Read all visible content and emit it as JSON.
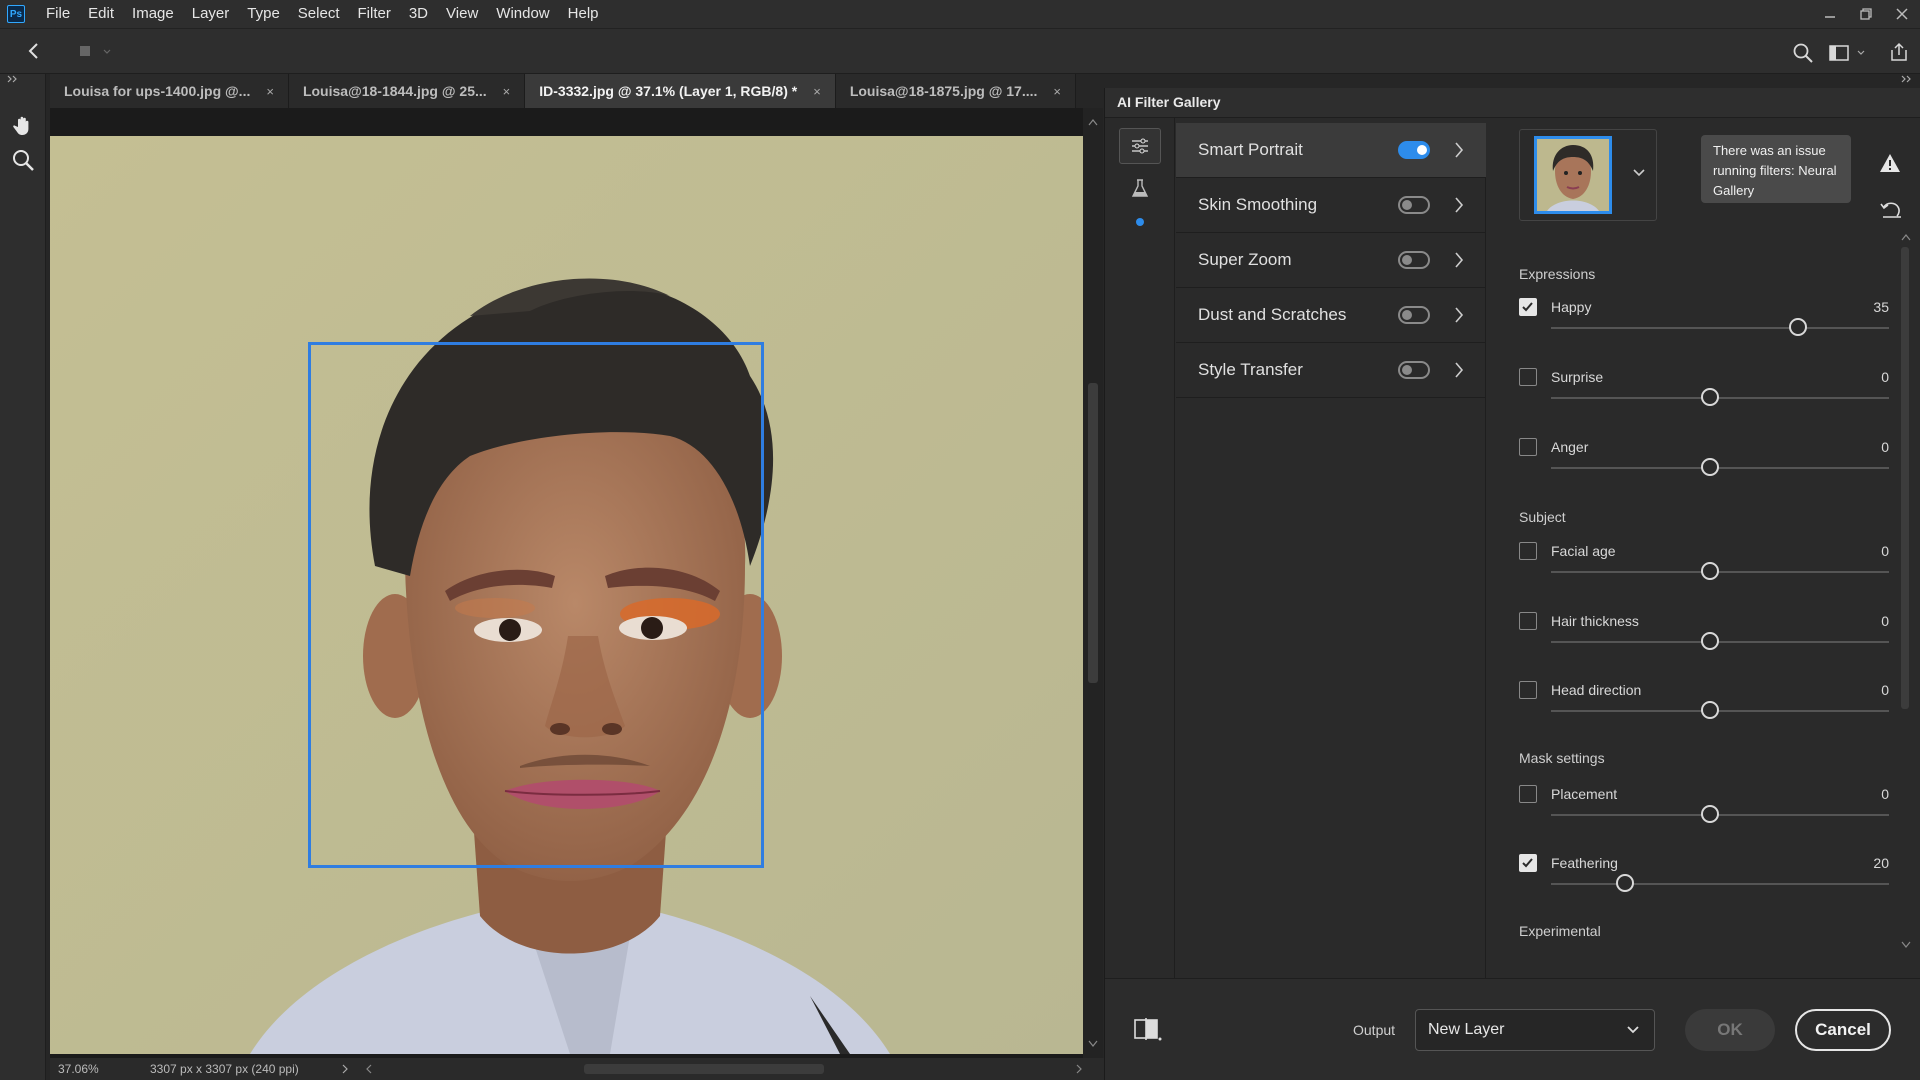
{
  "app": {
    "logo_text": "Ps"
  },
  "menu": [
    "File",
    "Edit",
    "Image",
    "Layer",
    "Type",
    "Select",
    "Filter",
    "3D",
    "View",
    "Window",
    "Help"
  ],
  "tabs": [
    {
      "label": "Louisa for ups-1400.jpg @...",
      "active": false
    },
    {
      "label": "Louisa@18-1844.jpg @ 25...",
      "active": false
    },
    {
      "label": "ID-3332.jpg @ 37.1% (Layer 1, RGB/8) *",
      "active": true
    },
    {
      "label": "Louisa@18-1875.jpg @ 17....",
      "active": false
    }
  ],
  "tab_close_glyph": "×",
  "status": {
    "zoom": "37.06%",
    "doc_info": "3307 px x 3307 px (240 ppi)"
  },
  "panel": {
    "title": "AI Filter Gallery",
    "filters": [
      {
        "name": "Smart Portrait",
        "enabled": true
      },
      {
        "name": "Skin Smoothing",
        "enabled": false
      },
      {
        "name": "Super Zoom",
        "enabled": false
      },
      {
        "name": "Dust and Scratches",
        "enabled": false
      },
      {
        "name": "Style Transfer",
        "enabled": false
      }
    ],
    "tooltip": "There was an issue running filters: Neural Gallery",
    "sections": {
      "expressions": "Expressions",
      "subject": "Subject",
      "mask": "Mask settings",
      "experimental": "Experimental"
    },
    "options": {
      "happy": {
        "label": "Happy",
        "value": "35",
        "checked": true,
        "level": 0.73
      },
      "surprise": {
        "label": "Surprise",
        "value": "0",
        "checked": false,
        "level": 0.47
      },
      "anger": {
        "label": "Anger",
        "value": "0",
        "checked": false,
        "level": 0.47
      },
      "facial_age": {
        "label": "Facial age",
        "value": "0",
        "checked": false,
        "level": 0.47
      },
      "hair_thickness": {
        "label": "Hair thickness",
        "value": "0",
        "checked": false,
        "level": 0.47
      },
      "head_direction": {
        "label": "Head direction",
        "value": "0",
        "checked": false,
        "level": 0.47
      },
      "placement": {
        "label": "Placement",
        "value": "0",
        "checked": false,
        "level": 0.47
      },
      "feathering": {
        "label": "Feathering",
        "value": "20",
        "checked": true,
        "level": 0.22
      }
    },
    "footer": {
      "output_label": "Output",
      "output_value": "New Layer",
      "ok": "OK",
      "cancel": "Cancel"
    }
  },
  "colors": {
    "accent": "#2d8ceb",
    "face_box": "#2f7de1"
  }
}
